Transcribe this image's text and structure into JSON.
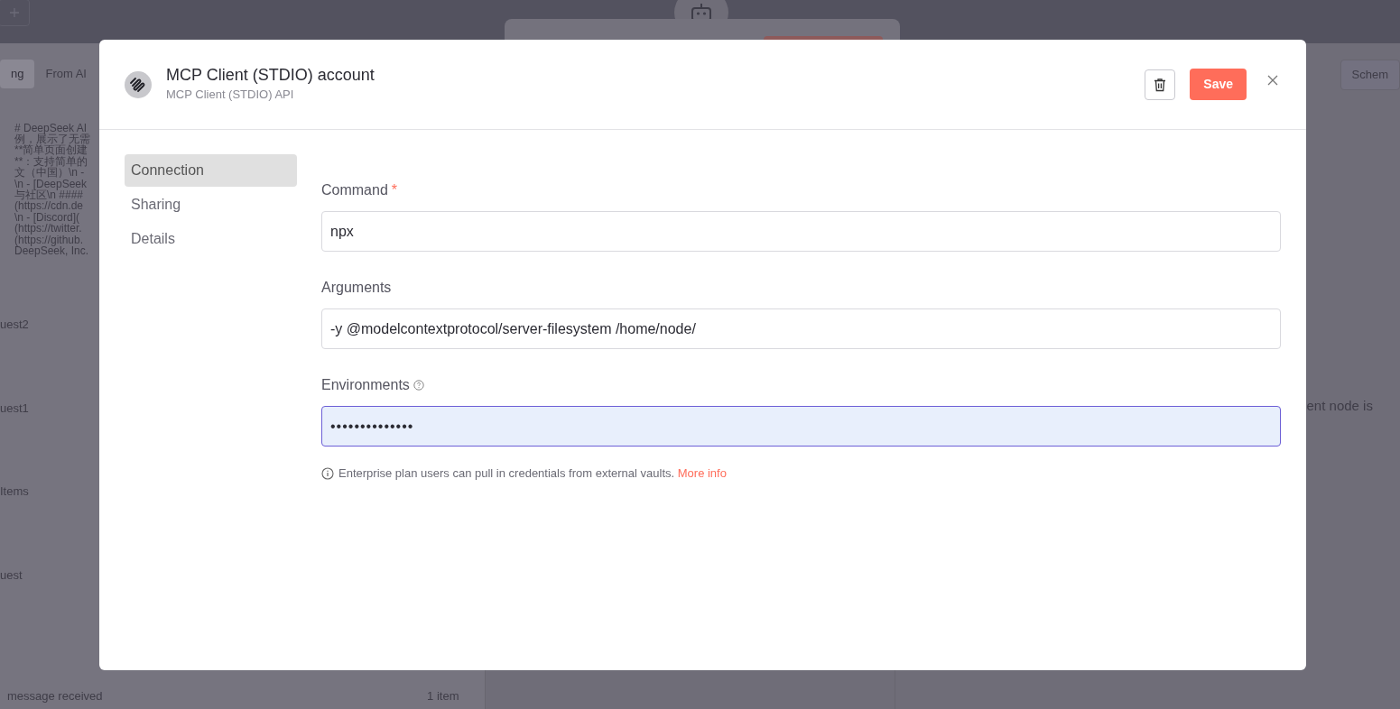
{
  "background": {
    "tabs": [
      {
        "label": "ng",
        "selected": true
      },
      {
        "label": "From AI",
        "selected": false
      }
    ],
    "code_lines": [
      "# DeepSeek AI",
      "例，展示了无需",
      "**简单页面创建",
      "**：支持简单的",
      "文（中国）\\n -",
      "\\n - [DeepSeek",
      "与社区\\n ####",
      "(https://cdn.de",
      "\\n - [Discord](",
      "(https://twitter.",
      "(https://github.",
      "DeepSeek, Inc."
    ],
    "items": [
      "uest2",
      "uest1",
      "Items",
      "uest"
    ],
    "bottom_row": {
      "label": "message received",
      "count": "1 item"
    },
    "right_tab": "Schem",
    "right_text": "ent node is"
  },
  "dialog": {
    "title": "MCP Client (STDIO) account",
    "subtitle": "MCP Client (STDIO) API",
    "save": "Save",
    "nav": [
      {
        "label": "Connection",
        "selected": true
      },
      {
        "label": "Sharing",
        "selected": false
      },
      {
        "label": "Details",
        "selected": false
      }
    ],
    "fields": [
      {
        "label": "Command",
        "required_mark": "*",
        "value": "npx",
        "focused": false
      },
      {
        "label": "Arguments",
        "value": "-y @modelcontextprotocol/server-filesystem /home/node/",
        "focused": false
      },
      {
        "label": "Environments",
        "value": "••••••••••••••",
        "focused": true,
        "help": true
      }
    ],
    "note": "Enterprise plan users can pull in credentials from external vaults.",
    "note_link": "More info"
  }
}
